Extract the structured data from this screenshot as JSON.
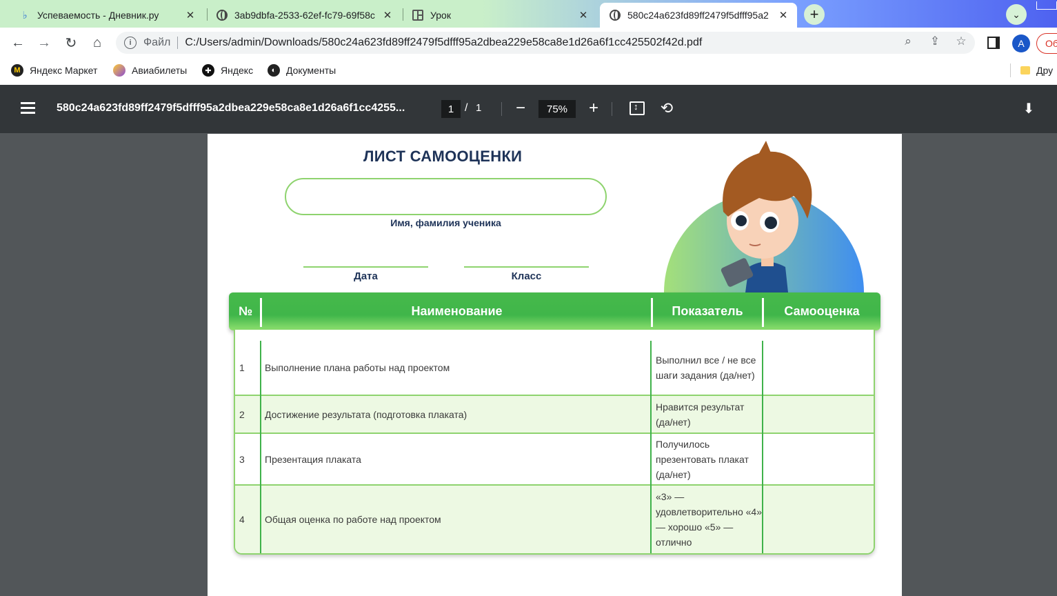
{
  "tabs": [
    {
      "title": "Успеваемость - Дневник.ру",
      "icon": "dnevnik-icon"
    },
    {
      "title": "3ab9dbfa-2533-62ef-fc79-69f58c",
      "icon": "globe-icon"
    },
    {
      "title": "Урок",
      "icon": "grid-icon"
    },
    {
      "title": "580c24a623fd89ff2479f5dfff95a2",
      "icon": "globe-icon",
      "active": true
    }
  ],
  "omnibox": {
    "scheme": "Файл",
    "url": "C:/Users/admin/Downloads/580c24a623fd89ff2479f5dfff95a2dbea229e58ca8e1d26a6f1cc425502f42d.pdf"
  },
  "profile": {
    "initial": "A",
    "update_label": "Об"
  },
  "bookmarks": [
    {
      "label": "Яндекс Маркет",
      "icon": "yandex-market-icon"
    },
    {
      "label": "Авиабилеты",
      "icon": "planet-icon"
    },
    {
      "label": "Яндекс",
      "icon": "globe-icon"
    },
    {
      "label": "Документы",
      "icon": "globe-icon"
    }
  ],
  "bookmarks_other": "Дру",
  "pdf_viewer": {
    "title": "580c24a623fd89ff2479f5dfff95a2dbea229e58ca8e1d26a6f1cc4255...",
    "page": "1",
    "page_sep": "/",
    "total_pages": "1",
    "zoom": "75%"
  },
  "document": {
    "title": "ЛИСТ САМООЦЕНКИ",
    "name_label": "Имя, фамилия ученика",
    "date_label": "Дата",
    "class_label": "Класс",
    "table": {
      "headers": [
        "№",
        "Наименование",
        "Показатель",
        "Самооценка"
      ],
      "rows": [
        {
          "num": "1",
          "name": "Выполнение плана работы над проектом",
          "indicator": "Выполнил все / не все шаги задания (да/нет)"
        },
        {
          "num": "2",
          "name": "Достижение результата (подготовка плаката)",
          "indicator": "Нравится результат (да/нет)"
        },
        {
          "num": "3",
          "name": "Презентация плаката",
          "indicator": "Получилось презентовать плакат (да/нет)"
        },
        {
          "num": "4",
          "name": "Общая оценка по работе над проектом",
          "indicator": "«3» — удовлетворительно «4» — хорошо «5» — отлично"
        }
      ]
    }
  },
  "colors": {
    "table_header": "#40b64a",
    "table_border": "#8ed36e",
    "title": "#1e3358",
    "viewer_bar": "#323639"
  }
}
